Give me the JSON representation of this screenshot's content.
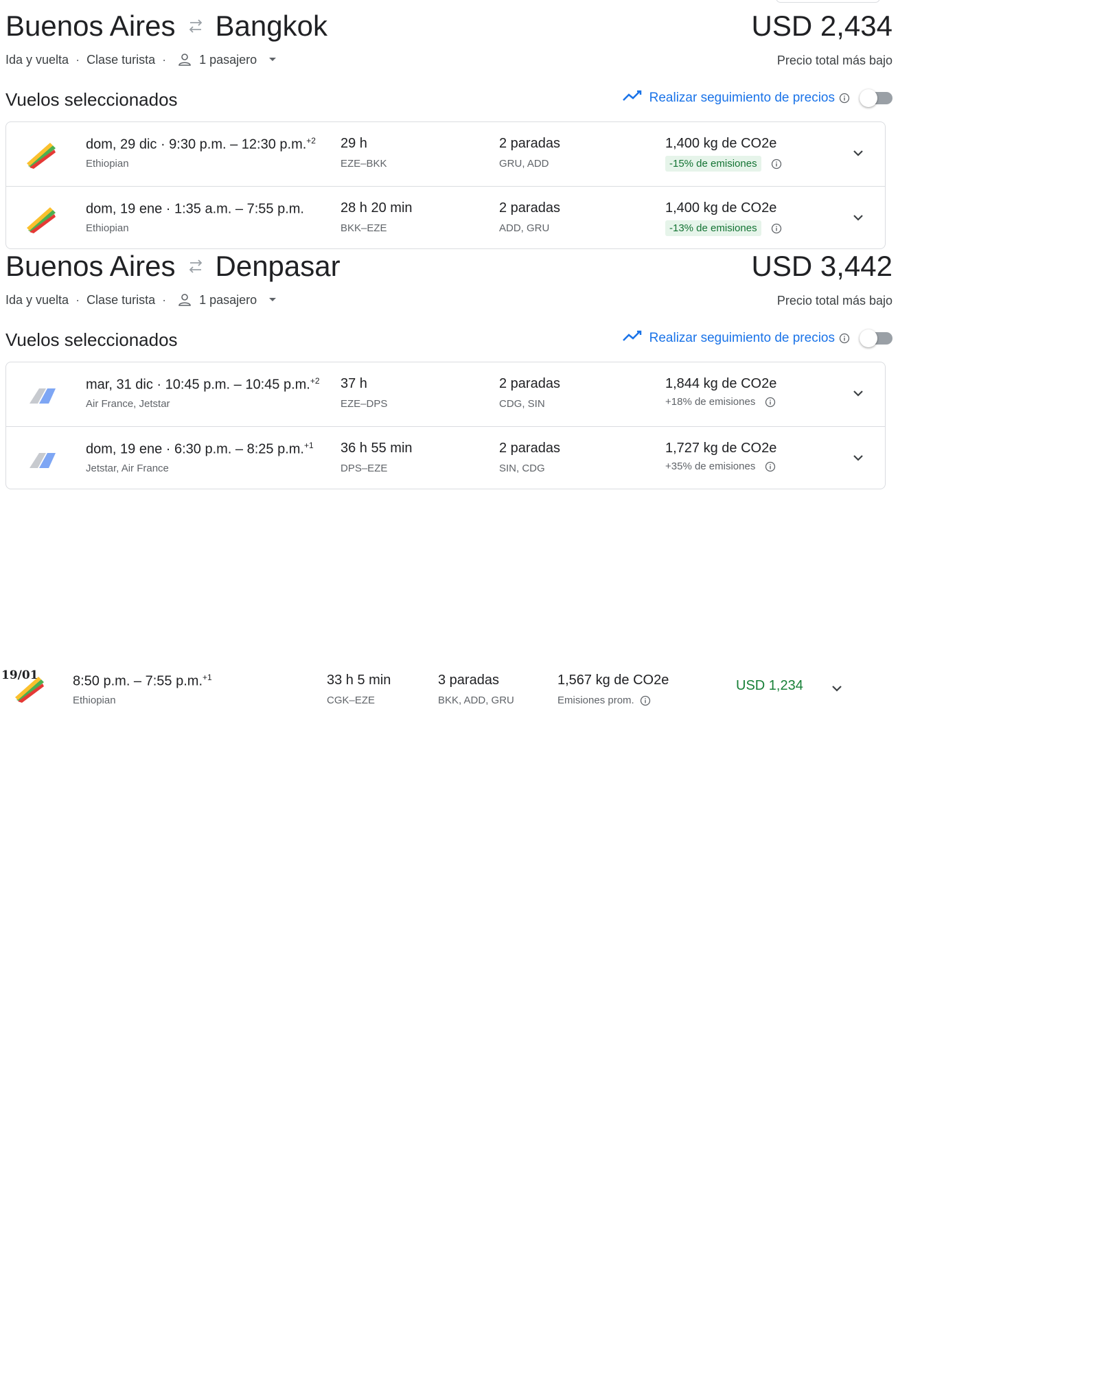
{
  "trips": [
    {
      "origin": "Buenos Aires",
      "destination": "Bangkok",
      "price": "USD 2,434",
      "price_note": "Precio total más bajo",
      "trip_type": "Ida y vuelta",
      "cabin": "Clase turista",
      "passengers": "1 pasajero",
      "selected_label": "Vuelos seleccionados",
      "track_label": "Realizar seguimiento de precios",
      "flights": [
        {
          "date": "dom, 29 dic",
          "times": "9:30 p.m. – 12:30 p.m.",
          "day_offset": "+2",
          "airline": "Ethiopian",
          "logo": "ethiopian",
          "duration": "29 h",
          "codes": "EZE–BKK",
          "stops": "2 paradas",
          "stop_codes": "GRU, ADD",
          "co2": "1,400 kg de CO2e",
          "emissions": "-15% de emisiones",
          "emissions_badge": true
        },
        {
          "date": "dom, 19 ene",
          "times": "1:35 a.m. – 7:55 p.m.",
          "day_offset": "",
          "airline": "Ethiopian",
          "logo": "ethiopian",
          "duration": "28 h 20 min",
          "codes": "BKK–EZE",
          "stops": "2 paradas",
          "stop_codes": "ADD, GRU",
          "co2": "1,400 kg de CO2e",
          "emissions": "-13% de emisiones",
          "emissions_badge": true
        }
      ]
    },
    {
      "origin": "Buenos Aires",
      "destination": "Denpasar",
      "price": "USD 3,442",
      "price_note": "Precio total más bajo",
      "trip_type": "Ida y vuelta",
      "cabin": "Clase turista",
      "passengers": "1 pasajero",
      "selected_label": "Vuelos seleccionados",
      "track_label": "Realizar seguimiento de precios",
      "flights": [
        {
          "date": "mar, 31 dic",
          "times": "10:45 p.m. – 10:45 p.m.",
          "day_offset": "+2",
          "airline": "Air France, Jetstar",
          "logo": "multi",
          "duration": "37 h",
          "codes": "EZE–DPS",
          "stops": "2 paradas",
          "stop_codes": "CDG, SIN",
          "co2": "1,844 kg de CO2e",
          "emissions": "+18% de emisiones",
          "emissions_badge": false
        },
        {
          "date": "dom, 19 ene",
          "times": "6:30 p.m. – 8:25 p.m.",
          "day_offset": "+1",
          "airline": "Jetstar, Air France",
          "logo": "multi",
          "duration": "36 h 55 min",
          "codes": "DPS–EZE",
          "stops": "2 paradas",
          "stop_codes": "SIN, CDG",
          "co2": "1,727 kg de CO2e",
          "emissions": "+35% de emisiones",
          "emissions_badge": false
        }
      ]
    }
  ],
  "solo": {
    "date_tag": "19/01",
    "times": "8:50 p.m. – 7:55 p.m.",
    "day_offset": "+1",
    "airline": "Ethiopian",
    "duration": "33 h 5 min",
    "codes": "CGK–EZE",
    "stops": "3 paradas",
    "stop_codes": "BKK, ADD, GRU",
    "co2": "1,567 kg de CO2e",
    "emissions": "Emisiones prom.",
    "price": "USD 1,234"
  },
  "colors": {
    "accent": "#1a73e8",
    "price_green": "#188038",
    "badge_bg": "#e6f4ea",
    "badge_text": "#137333",
    "border": "#dadce0"
  },
  "icons": [
    "swap-arrows-icon",
    "person-icon",
    "dropdown-caret-icon",
    "trend-line-icon",
    "info-icon",
    "chevron-down-icon",
    "ethiopian-logo",
    "multi-airline-logo"
  ]
}
